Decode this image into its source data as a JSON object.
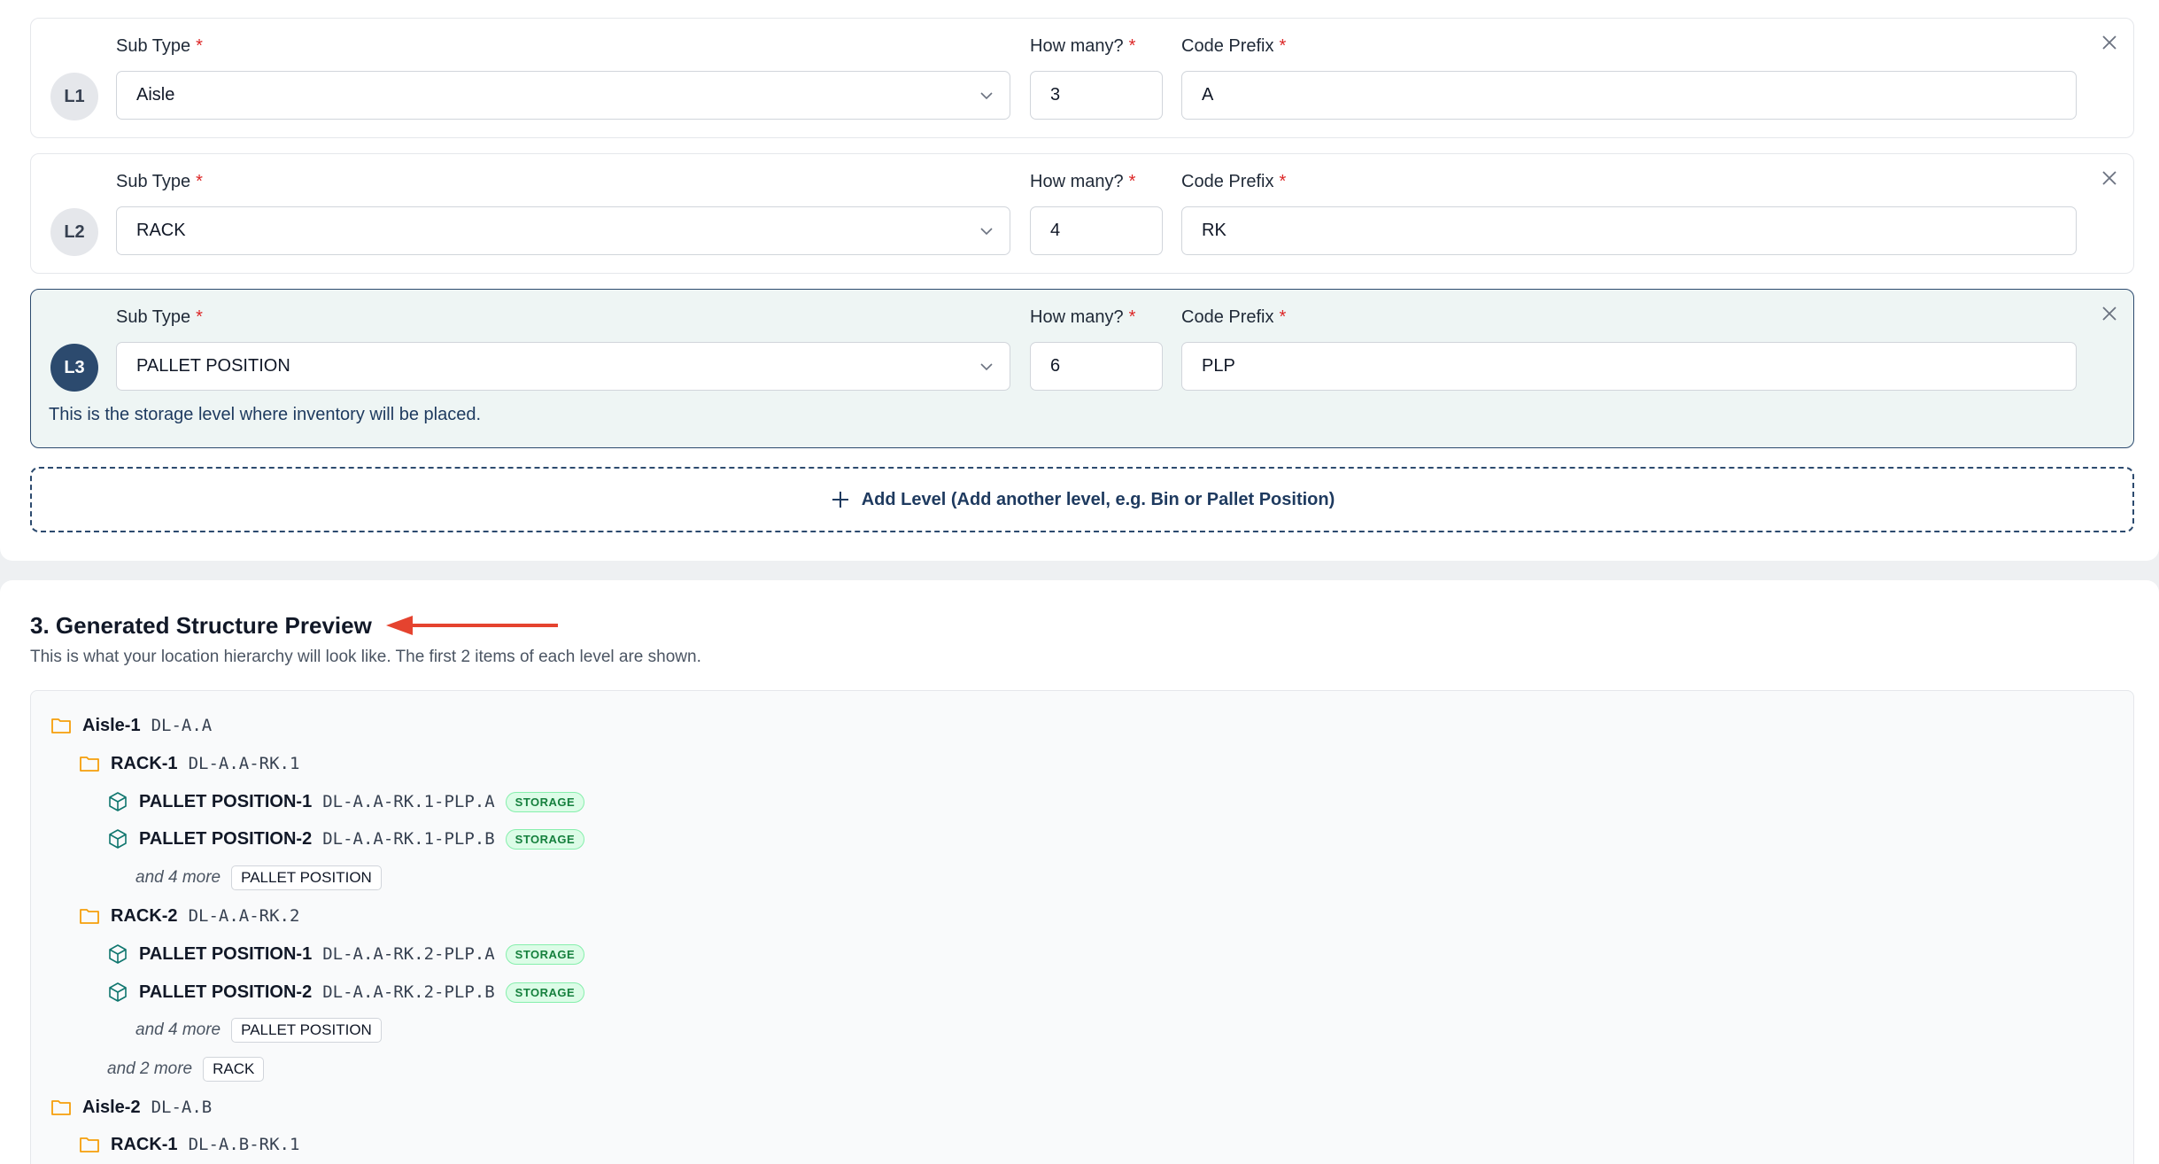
{
  "levels": [
    {
      "badge": "L1",
      "sub_type_label": "Sub Type",
      "sub_type_value": "Aisle",
      "how_many_label": "How many?",
      "how_many_value": "3",
      "code_prefix_label": "Code Prefix",
      "code_prefix_value": "A"
    },
    {
      "badge": "L2",
      "sub_type_label": "Sub Type",
      "sub_type_value": "RACK",
      "how_many_label": "How many?",
      "how_many_value": "4",
      "code_prefix_label": "Code Prefix",
      "code_prefix_value": "RK"
    },
    {
      "badge": "L3",
      "sub_type_label": "Sub Type",
      "sub_type_value": "PALLET POSITION",
      "how_many_label": "How many?",
      "how_many_value": "6",
      "code_prefix_label": "Code Prefix",
      "code_prefix_value": "PLP",
      "note": "This is the storage level where inventory will be placed."
    }
  ],
  "required_mark": "*",
  "add_level_label": "Add Level (Add another level, e.g. Bin or Pallet Position)",
  "preview": {
    "title": "3. Generated Structure Preview",
    "subtitle": "This is what your location hierarchy will look like. The first 2 items of each level are shown.",
    "storage_badge": "STORAGE",
    "rows": [
      {
        "type": "folder",
        "name": "Aisle-1",
        "code": "DL-A.A"
      },
      {
        "type": "folder",
        "name": "RACK-1",
        "code": "DL-A.A-RK.1"
      },
      {
        "type": "item",
        "name": "PALLET POSITION-1",
        "code": "DL-A.A-RK.1-PLP.A"
      },
      {
        "type": "item",
        "name": "PALLET POSITION-2",
        "code": "DL-A.A-RK.1-PLP.B"
      },
      {
        "type": "more",
        "text": "and 4 more",
        "tag": "PALLET POSITION"
      },
      {
        "type": "folder",
        "name": "RACK-2",
        "code": "DL-A.A-RK.2"
      },
      {
        "type": "item",
        "name": "PALLET POSITION-1",
        "code": "DL-A.A-RK.2-PLP.A"
      },
      {
        "type": "item",
        "name": "PALLET POSITION-2",
        "code": "DL-A.A-RK.2-PLP.B"
      },
      {
        "type": "more",
        "text": "and 4 more",
        "tag": "PALLET POSITION"
      },
      {
        "type": "more",
        "text": "and 2 more",
        "tag": "RACK"
      },
      {
        "type": "folder",
        "name": "Aisle-2",
        "code": "DL-A.B"
      },
      {
        "type": "folder",
        "name": "RACK-1",
        "code": "DL-A.B-RK.1"
      }
    ]
  },
  "icons": {
    "folder": "folder-icon",
    "item": "box-icon",
    "add": "plus-icon",
    "close": "close-icon",
    "dropdown": "chevron-down-icon",
    "annotation": "arrow-annotation"
  },
  "colors": {
    "primary": "#2c4a6e",
    "required": "#dc2626",
    "folder": "#f59e0b",
    "item": "#0f766e",
    "storage_bg": "#dcfce7",
    "arrow": "#e5432f"
  }
}
